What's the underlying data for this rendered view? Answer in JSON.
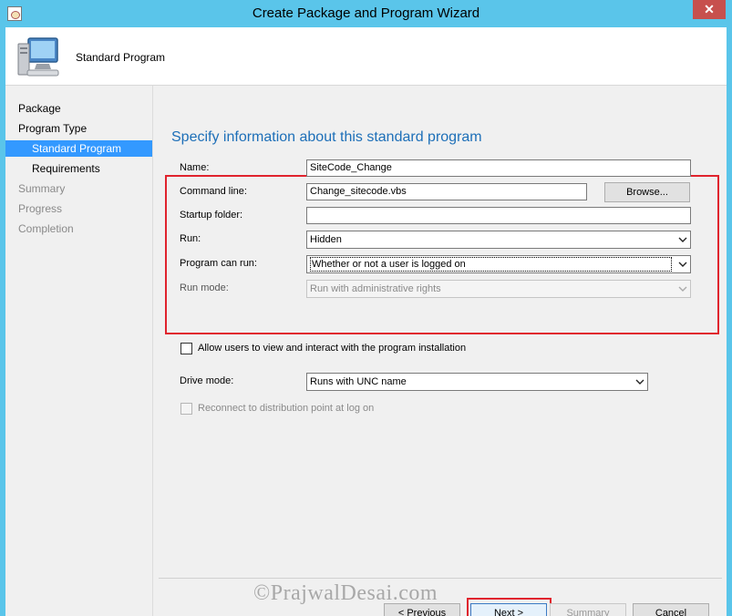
{
  "window": {
    "title": "Create Package and Program Wizard",
    "close_label": "✕"
  },
  "header": {
    "title": "Standard Program",
    "icon": "computer-icon"
  },
  "nav": {
    "items": [
      {
        "label": "Package",
        "level": 0,
        "state": "normal"
      },
      {
        "label": "Program Type",
        "level": 0,
        "state": "normal"
      },
      {
        "label": "Standard Program",
        "level": 1,
        "state": "active"
      },
      {
        "label": "Requirements",
        "level": 1,
        "state": "normal"
      },
      {
        "label": "Summary",
        "level": 0,
        "state": "disabled"
      },
      {
        "label": "Progress",
        "level": 0,
        "state": "disabled"
      },
      {
        "label": "Completion",
        "level": 0,
        "state": "disabled"
      }
    ]
  },
  "main": {
    "heading": "Specify information about this standard program",
    "fields": {
      "name": {
        "label": "Name:",
        "value": "SiteCode_Change"
      },
      "command_line": {
        "label": "Command line:",
        "value": "Change_sitecode.vbs",
        "browse_label": "Browse..."
      },
      "startup_folder": {
        "label": "Startup folder:",
        "value": ""
      },
      "run": {
        "label": "Run:",
        "value": "Hidden"
      },
      "program_can_run": {
        "label": "Program can run:",
        "value": "Whether or not a user is logged on"
      },
      "run_mode": {
        "label": "Run mode:",
        "value": "Run with administrative rights"
      }
    },
    "allow_interact": {
      "label": "Allow users to view and interact with the program installation",
      "checked": false
    },
    "drive_mode": {
      "label": "Drive mode:",
      "value": "Runs with UNC name"
    },
    "reconnect": {
      "label": "Reconnect to distribution point at log on",
      "checked": false,
      "enabled": false
    }
  },
  "footer": {
    "previous_label": "< Previous",
    "next_label": "Next >",
    "summary_label": "Summary",
    "cancel_label": "Cancel"
  },
  "watermark": "©PrajwalDesai.com",
  "colors": {
    "accent": "#3399ff",
    "heading": "#1d6fb8",
    "highlight": "#e0232d",
    "frame": "#5ac5ea"
  }
}
